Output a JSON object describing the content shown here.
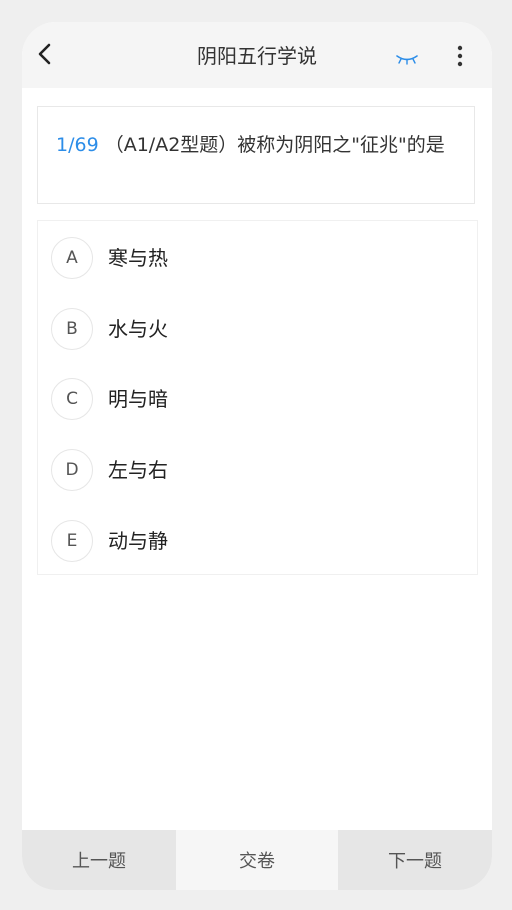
{
  "header": {
    "title": "阴阳五行学说",
    "back_icon": "chevron-left-icon",
    "eye_icon": "eye-closed-icon",
    "more_icon": "more-vertical-icon",
    "accent_color": "#2c8de8"
  },
  "question": {
    "number": "1/69",
    "text": "（A1/A2型题）被称为阴阳之\"征兆\"的是"
  },
  "options": [
    {
      "letter": "A",
      "text": "寒与热"
    },
    {
      "letter": "B",
      "text": "水与火"
    },
    {
      "letter": "C",
      "text": "明与暗"
    },
    {
      "letter": "D",
      "text": "左与右"
    },
    {
      "letter": "E",
      "text": "动与静"
    }
  ],
  "footer": {
    "prev_label": "上一题",
    "submit_label": "交卷",
    "next_label": "下一题"
  }
}
